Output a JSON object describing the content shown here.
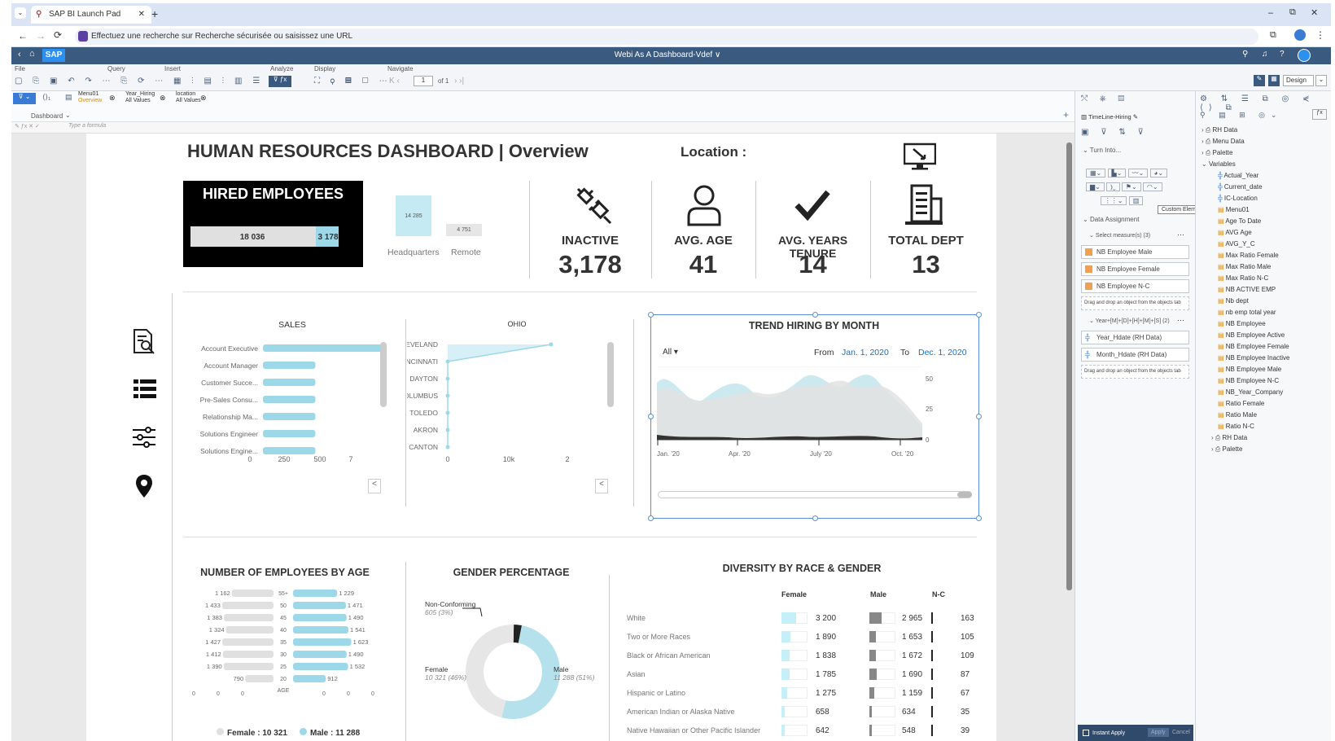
{
  "browser": {
    "tab_title": "SAP BI Launch Pad",
    "address": "Effectuez une recherche sur Recherche sécurisée ou saisissez une URL"
  },
  "sap": {
    "logo": "SAP",
    "doc_title": "Webi As A Dashboard-Vdef ∨",
    "design_label": "Design"
  },
  "toolbar": {
    "file": "File",
    "query": "Query",
    "insert": "Insert",
    "analyze": "Analyze",
    "display": "Display",
    "navigate": "Navigate",
    "page": "1",
    "of": "of 1"
  },
  "tabs": {
    "menu": "Menu01",
    "menu_sub": "Overview",
    "year": "Year_Hiring",
    "year_sub": "All Values",
    "loc": "location",
    "loc_sub": "All Values",
    "dashboard": "Dashboard"
  },
  "formula_placeholder": "Type a formula",
  "dashboard": {
    "title": "HUMAN RESOURCES DASHBOARD | Overview",
    "location": "Location :",
    "hired": {
      "title": "HIRED EMPLOYEES",
      "v1": "18 036",
      "v2": "3 178"
    },
    "hq": {
      "hq_val": "14 285",
      "remote_val": "4 751",
      "hq": "Headquarters",
      "remote": "Remote"
    },
    "kpis": [
      {
        "label": "INACTIVE",
        "value": "3,178"
      },
      {
        "label": "AVG. AGE",
        "value": "41"
      },
      {
        "label": "AVG. YEARS TENURE",
        "value": "14"
      },
      {
        "label": "TOTAL DEPT",
        "value": "13"
      }
    ]
  },
  "chart_data": [
    {
      "type": "bar",
      "title": "SALES",
      "categories": [
        "Account Executive",
        "Account Manager",
        "Customer Succe...",
        "Pre-Sales Consu...",
        "Relationship Ma...",
        "Solutions Engineer",
        "Solutions Engine..."
      ],
      "values": [
        580,
        250,
        250,
        250,
        250,
        250,
        250
      ],
      "xticks": [
        "0",
        "250",
        "500",
        "7"
      ]
    },
    {
      "type": "line",
      "title": "OHIO",
      "categories": [
        "CLEVELAND",
        "CINCINNATI",
        "DAYTON",
        "COLUMBUS",
        "TOLEDO",
        "AKRON",
        "CANTON"
      ],
      "values": [
        18000,
        0,
        0,
        0,
        0,
        0,
        0
      ],
      "xticks": [
        "0",
        "10k",
        "2"
      ]
    },
    {
      "type": "area",
      "title": "TREND HIRING BY MONTH",
      "filter": "All",
      "from_label": "From",
      "from": "Jan. 1, 2020",
      "to_label": "To",
      "to": "Dec. 1, 2020",
      "xticks": [
        "Jan. '20",
        "Apr. '20",
        "July '20",
        "Oct. '20"
      ],
      "yticks": [
        "50",
        "25",
        "0"
      ]
    },
    {
      "type": "bar",
      "title": "NUMBER OF EMPLOYEES BY AGE",
      "categories": [
        "55+",
        "50",
        "45",
        "40",
        "35",
        "30",
        "25",
        "20"
      ],
      "female": [
        1162,
        1433,
        1383,
        1324,
        1427,
        1412,
        1390,
        790
      ],
      "male": [
        1229,
        1471,
        1490,
        1541,
        1623,
        1490,
        1532,
        912
      ],
      "female_labels": [
        "1 162",
        "1 433",
        "1 383",
        "1 324",
        "1 427",
        "1 412",
        "1 390",
        "790"
      ],
      "male_labels": [
        "1 229",
        "1 471",
        "1 490",
        "1 541",
        "1 623",
        "1 490",
        "1 532",
        "912"
      ],
      "axis_label": "AGE",
      "bottom_ticks": [
        "0",
        "0",
        "0",
        "0",
        "0",
        "0"
      ],
      "legend_female": "Female : 10 321",
      "legend_male": "Male : 11 288"
    },
    {
      "type": "pie",
      "title": "GENDER PERCENTAGE",
      "slices": [
        {
          "name": "Non-Conforming",
          "label": "605 (3%)",
          "value": 605
        },
        {
          "name": "Female",
          "label": "10 321 (46%)",
          "value": 10321
        },
        {
          "name": "Male",
          "label": "11 288 (51%)",
          "value": 11288
        }
      ]
    },
    {
      "type": "table",
      "title": "DIVERSITY BY RACE & GENDER",
      "columns": [
        "Female",
        "Male",
        "N-C"
      ],
      "rows": [
        {
          "name": "White",
          "female": "3 200",
          "male": "2 965",
          "nc": "163"
        },
        {
          "name": "Two or More Races",
          "female": "1 890",
          "male": "1 653",
          "nc": "105"
        },
        {
          "name": "Black or African American",
          "female": "1 838",
          "male": "1 672",
          "nc": "109"
        },
        {
          "name": "Asian",
          "female": "1 785",
          "male": "1 690",
          "nc": "87"
        },
        {
          "name": "Hispanic or Latino",
          "female": "1 275",
          "male": "1 159",
          "nc": "67"
        },
        {
          "name": "American Indian or Alaska Native",
          "female": "658",
          "male": "634",
          "nc": "35"
        },
        {
          "name": "Native Hawaiian or Other Pacific Islander",
          "female": "642",
          "male": "548",
          "nc": "39"
        }
      ]
    }
  ],
  "panel": {
    "element_name": "TimeLine-Hiring",
    "turn_into": "Turn Into...",
    "tooltip": "Custom Element... Selected",
    "data_assignment": "Data Assignment",
    "measures_hdr": "Select measure(s) (3)",
    "measures": [
      "NB Employee Male",
      "NB Employee Female",
      "NB Employee N-C"
    ],
    "drop_hint": "Drag and drop an object from the objects tab",
    "dims_hdr": "Year+[M]+[D]+[H]+[M]+[S] (2)",
    "dims": [
      "Year_Hdate (RH Data)",
      "Month_Hdate (RH Data)"
    ],
    "instant_apply": "Instant Apply",
    "apply": "Apply",
    "cancel": "Cancel"
  },
  "objects": {
    "top": [
      "RH Data",
      "Menu Data",
      "Palette",
      "Variables"
    ],
    "vars": [
      "Actual_Year",
      "Current_date",
      "IC-Location"
    ],
    "menu_item": "Menu01",
    "items": [
      "Age To Date",
      "AVG Age",
      "AVG_Y_C",
      "Max Ratio Female",
      "Max Ratio Male",
      "Max Ratio N-C",
      "NB ACTIVE EMP",
      "Nb dept",
      "nb emp total year",
      "NB Employee",
      "NB Employee Active",
      "NB Employee Female",
      "NB Employee Inactive",
      "NB Employee Male",
      "NB Employee N-C",
      "NB_Year_Company",
      "Ratio Female",
      "Ratio Male",
      "Ratio N-C"
    ],
    "bottom": [
      "RH Data",
      "Palette"
    ]
  }
}
